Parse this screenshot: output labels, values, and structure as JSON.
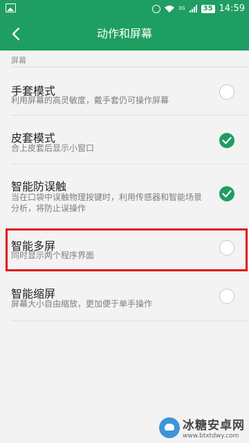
{
  "status_bar": {
    "network_label": "3G",
    "battery": "35",
    "time": "14:59"
  },
  "header": {
    "title": "动作和屏幕"
  },
  "section": {
    "label": "屏幕"
  },
  "settings": [
    {
      "title": "手套模式",
      "subtitle": "利用屏幕的高灵敏度，戴手套仍可操作屏幕",
      "checked": false
    },
    {
      "title": "皮套模式",
      "subtitle": "合上皮套后显示小窗口",
      "checked": true
    },
    {
      "title": "智能防误触",
      "subtitle": "当在口袋中误触物理按键时，利用传感器和智能场景分析，将防止误操作",
      "checked": true
    },
    {
      "title": "智能多屏",
      "subtitle": "同时显示两个程序界面",
      "checked": false
    },
    {
      "title": "智能缩屏",
      "subtitle": "屏幕大小自由缩放，更加便于单手操作",
      "checked": false
    }
  ],
  "watermark": {
    "name": "冰糖安卓网",
    "url": "www.btxtdwy.com"
  },
  "colors": {
    "accent": "#1e9e62",
    "highlight": "#e01010"
  }
}
